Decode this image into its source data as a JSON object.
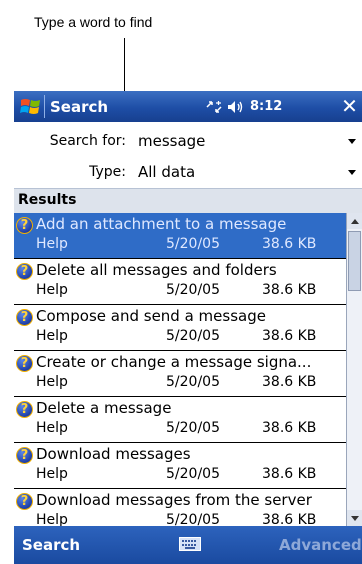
{
  "annotation": {
    "top_text": "Type a word to find"
  },
  "titlebar": {
    "title": "Search",
    "time": "8:12",
    "close_label": "✕"
  },
  "form": {
    "search_label": "Search for:",
    "search_value": "message",
    "type_label": "Type:",
    "type_value": "All data"
  },
  "results": {
    "header": "Results",
    "items": [
      {
        "title": "Add an attachment to a message",
        "category": "Help",
        "date": "5/20/05",
        "size": "38.6 KB",
        "selected": true
      },
      {
        "title": "Delete all messages and folders",
        "category": "Help",
        "date": "5/20/05",
        "size": "38.6 KB"
      },
      {
        "title": "Compose and send a message",
        "category": "Help",
        "date": "5/20/05",
        "size": "38.6 KB"
      },
      {
        "title": "Create or change a message signa...",
        "category": "Help",
        "date": "5/20/05",
        "size": "38.6 KB"
      },
      {
        "title": "Delete a message",
        "category": "Help",
        "date": "5/20/05",
        "size": "38.6 KB"
      },
      {
        "title": "Download messages",
        "category": "Help",
        "date": "5/20/05",
        "size": "38.6 KB"
      },
      {
        "title": "Download messages from the server",
        "category": "Help",
        "date": "5/20/05",
        "size": "38.6 KB"
      }
    ]
  },
  "menubar": {
    "left": "Search",
    "right": "Advanced"
  },
  "icons": {
    "help": "help-icon",
    "start": "windows-flag-icon",
    "connectivity": "connectivity-icon",
    "volume": "speaker-icon",
    "keyboard": "keyboard-icon"
  },
  "colors": {
    "titlebar": "#1e4ea6",
    "selection": "#2f6cc7",
    "help_icon": "#1f3fa6"
  }
}
